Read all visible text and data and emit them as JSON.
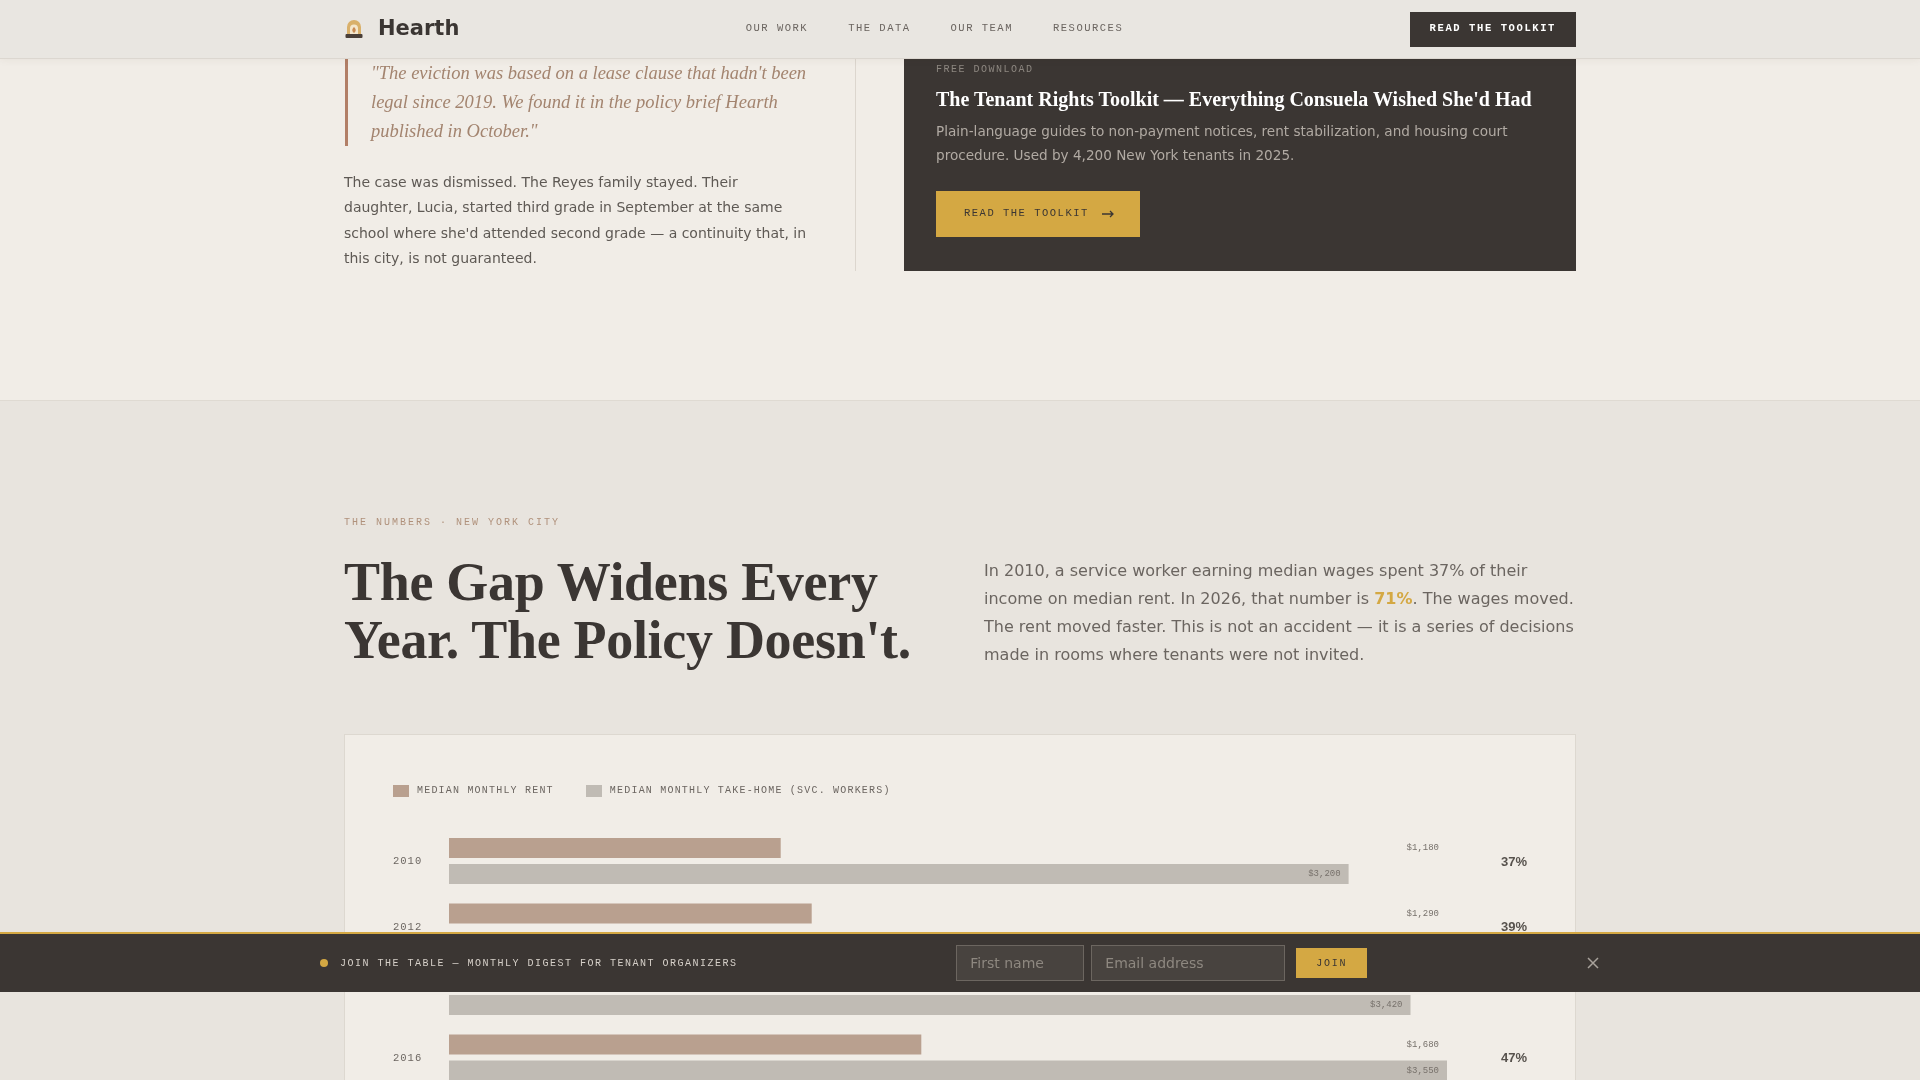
{
  "navbar": {
    "brand": "Hearth",
    "links": [
      {
        "label": "OUR WORK"
      },
      {
        "label": "THE DATA"
      },
      {
        "label": "OUR TEAM"
      },
      {
        "label": "RESOURCES"
      }
    ],
    "cta": "READ THE TOOLKIT"
  },
  "story": {
    "quote": "\"The eviction was based on a lease clause that hadn't been legal since 2019. We found it in the policy brief Hearth published in October.\"",
    "paragraph": "The case was dismissed. The Reyes family stayed. Their daughter, Lucia, started third grade in September at the same school where she'd attended second grade — a continuity that, in this city, is not guaranteed."
  },
  "toolkit_card": {
    "eyebrow": "FREE DOWNLOAD",
    "title": "The Tenant Rights Toolkit — Everything Consuela Wished She'd Had",
    "description": "Plain-language guides to non-payment notices, rent stabilization, and housing court procedure. Used by 4,200 New York tenants in 2025.",
    "button": "READ THE TOOLKIT"
  },
  "numbers": {
    "eyebrow": "THE NUMBERS · NEW YORK CITY",
    "heading": "The Gap Widens Every Year. The Policy Doesn't.",
    "intro": "In 2010, a service worker earning median wages spent 37% of their income on median rent. In 2026, that number is **71%**. The wages moved. The rent moved faster. This is not an accident — it is a series of decisions made in rooms where tenants were not invited."
  },
  "chart_panel": {
    "chart_data": {
      "type": "bar",
      "orientation": "horizontal",
      "legend": "top",
      "data_labels": true,
      "categories": [
        "2010",
        "2012",
        null,
        "2016"
      ],
      "series": [
        {
          "name": "MEDIAN MONTHLY RENT",
          "color": "#b9a08f",
          "values": [
            1180,
            1290,
            null,
            1680
          ],
          "value_labels": [
            "$1,180",
            "$1,290",
            null,
            "$1,680"
          ]
        },
        {
          "name": "MEDIAN MONTHLY TAKE-HOME (SVC. WORKERS)",
          "color": "#c0bbb4",
          "values": [
            3200,
            null,
            3420,
            3550
          ],
          "value_labels": [
            "$3,200",
            null,
            "$3,420",
            "$3,550"
          ]
        }
      ]
    },
    "rows": [
      {
        "share": "37%"
      },
      {
        "share": "39%"
      },
      {},
      {
        "share": "47%"
      }
    ]
  },
  "newsletter_bar": {
    "text": "JOIN THE TABLE — MONTHLY DIGEST FOR TENANT ORGANIZERS",
    "fields": [
      {
        "placeholder": "First name"
      },
      {
        "placeholder": "Email address"
      }
    ],
    "button": "JOIN"
  }
}
